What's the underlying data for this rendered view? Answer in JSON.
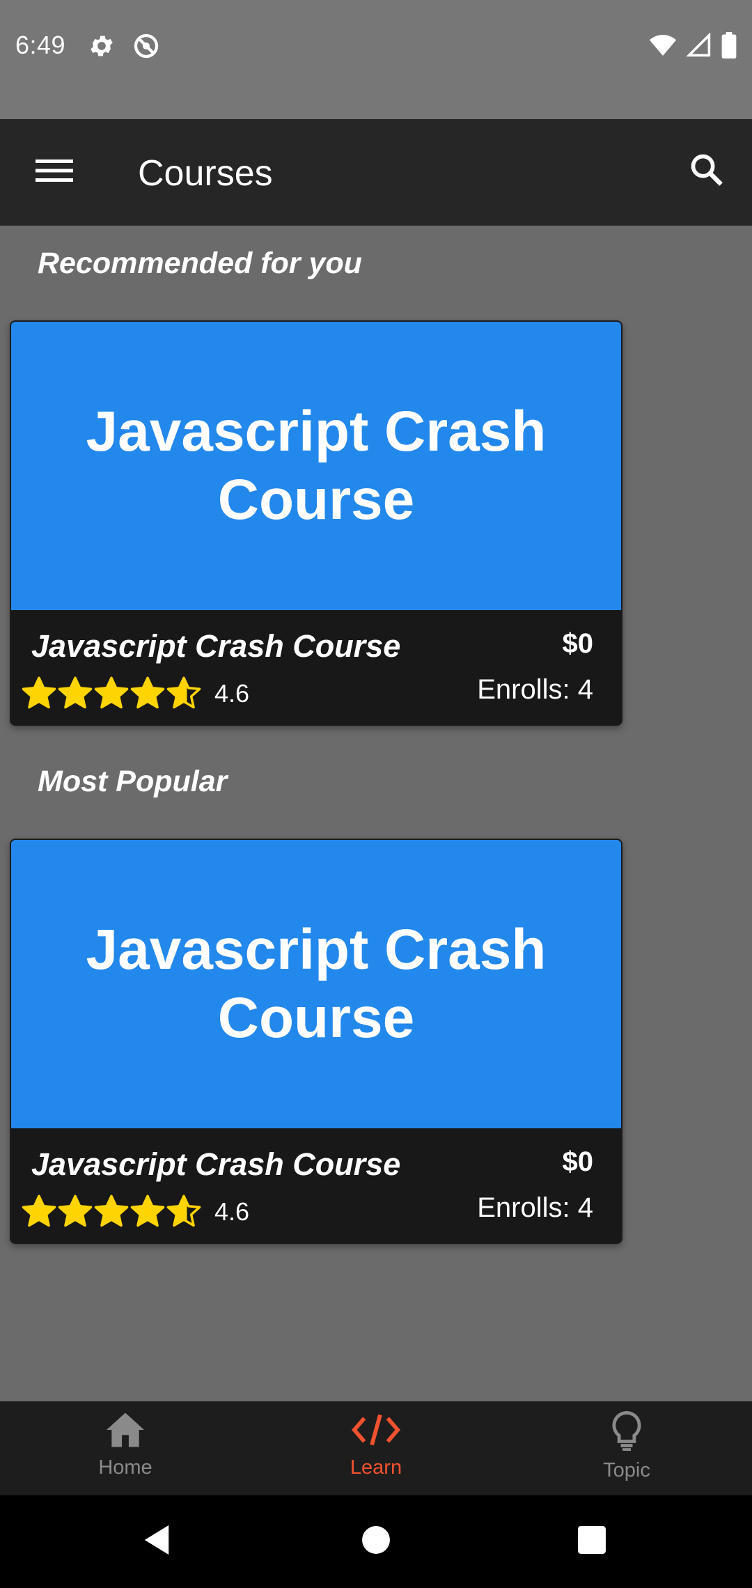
{
  "status_bar": {
    "time": "6:49",
    "icons": [
      "gear-icon",
      "do-not-disturb-icon",
      "wifi-icon",
      "signal-icon",
      "battery-icon"
    ]
  },
  "app_bar": {
    "title": "Courses",
    "menu_icon": "menu-icon",
    "search_icon": "search-icon"
  },
  "sections": [
    {
      "title": "Recommended for you",
      "card": {
        "banner_text": "Javascript Crash Course",
        "title": "Javascript Crash Course",
        "price": "$0",
        "rating": "4.6",
        "rating_value": 4.6,
        "enrolls": "Enrolls: 4"
      }
    },
    {
      "title": "Most Popular",
      "card": {
        "banner_text": "Javascript Crash Course",
        "title": "Javascript Crash Course",
        "price": "$0",
        "rating": "4.6",
        "rating_value": 4.6,
        "enrolls": "Enrolls: 4"
      }
    }
  ],
  "bottom_nav": {
    "items": [
      {
        "label": "Home",
        "icon": "home-icon",
        "active": false
      },
      {
        "label": "Learn",
        "icon": "code-icon",
        "active": true
      },
      {
        "label": "Topic",
        "icon": "lightbulb-icon",
        "active": false
      }
    ]
  },
  "colors": {
    "accent": "#f0522f",
    "banner": "#2388ec",
    "star": "#ffd400"
  },
  "system_nav": [
    "back-icon",
    "home-circle-icon",
    "recents-square-icon"
  ]
}
